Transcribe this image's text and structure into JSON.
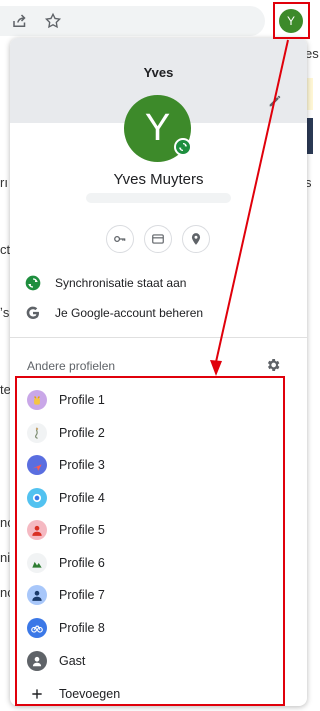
{
  "toolbar": {
    "avatar_letter": "Y",
    "icons": [
      "share-icon",
      "star-icon"
    ]
  },
  "panel": {
    "name": "Yves",
    "avatar_letter": "Y",
    "full_name": "Yves Muyters",
    "accent_color": "#3d8a2a",
    "sync_label": "Synchronisatie staat aan",
    "google_label": "Je Google-account beheren",
    "other_profiles_label": "Andere profielen",
    "profiles": [
      {
        "label": "Profile 1",
        "color": "#c9a7e8"
      },
      {
        "label": "Profile 2",
        "color": "#f1f3f4"
      },
      {
        "label": "Profile 3",
        "color": "#5a6ee0"
      },
      {
        "label": "Profile 4",
        "color": "#52c2f0"
      },
      {
        "label": "Profile 5",
        "color": "#f5b9c2"
      },
      {
        "label": "Profile 6",
        "color": "#f1f3f4"
      },
      {
        "label": "Profile 7",
        "color": "#a8c7fa"
      },
      {
        "label": "Profile 8",
        "color": "#3b78e7"
      }
    ],
    "guest_label": "Gast",
    "add_label": "Toevoegen"
  },
  "background": {
    "side_fragments": [
      "es",
      "s",
      "rı",
      "cti",
      "ʼs",
      "te",
      "nc",
      "ni",
      "nc"
    ]
  },
  "annotation_color": "#e0000b"
}
